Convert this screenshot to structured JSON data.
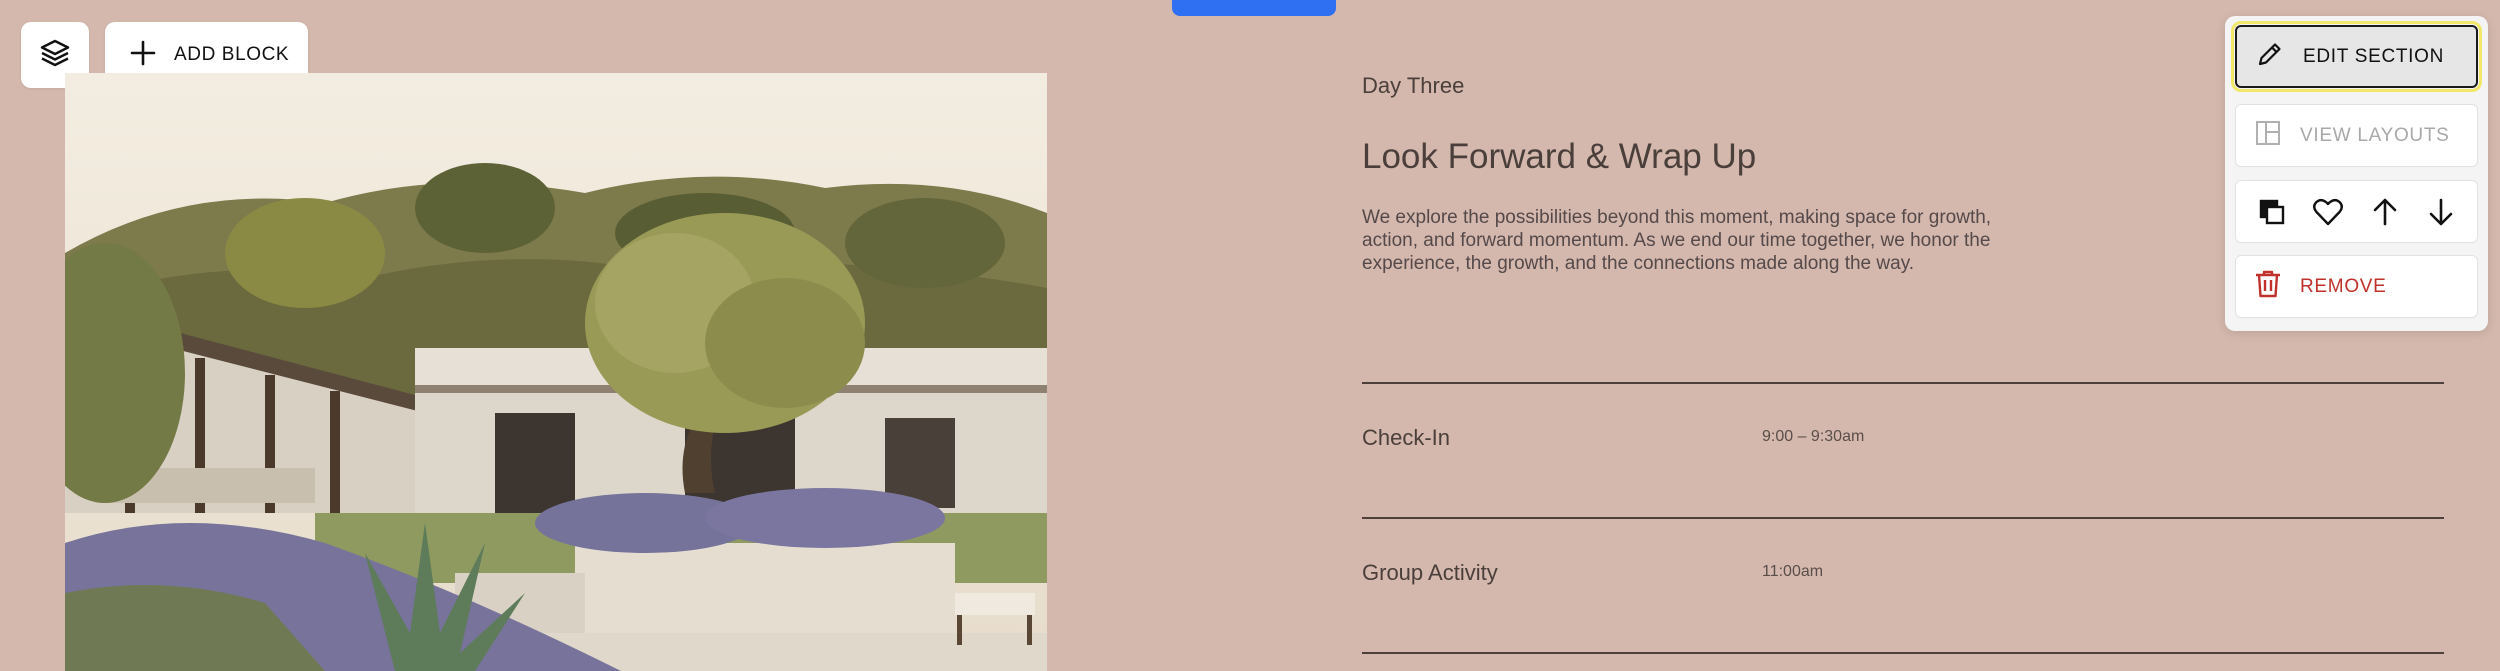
{
  "toolbar": {
    "add_block_label": "ADD BLOCK",
    "layers_icon": "layers-icon",
    "plus_icon": "plus-icon"
  },
  "section": {
    "eyebrow": "Day Three",
    "heading": "Look Forward & Wrap Up",
    "body": "We explore the possibilities beyond this moment, making space for growth, action, and forward momentum. As we end our time together, we honor the experience, the growth, and the connections made along the way.",
    "schedule": [
      {
        "title": "Check-In",
        "time": "9:00 – 9:30am"
      },
      {
        "title": "Group Activity",
        "time": "11:00am"
      }
    ]
  },
  "panel": {
    "edit_label": "EDIT SECTION",
    "layouts_label": "VIEW LAYOUTS",
    "remove_label": "REMOVE",
    "tools": [
      "duplicate-icon",
      "heart-icon",
      "arrow-up-icon",
      "arrow-down-icon"
    ]
  },
  "colors": {
    "background": "#d4b8ad",
    "accent_blue": "#2f6ff2",
    "remove_red": "#c0312b",
    "highlight_yellow": "#f1e86a"
  }
}
